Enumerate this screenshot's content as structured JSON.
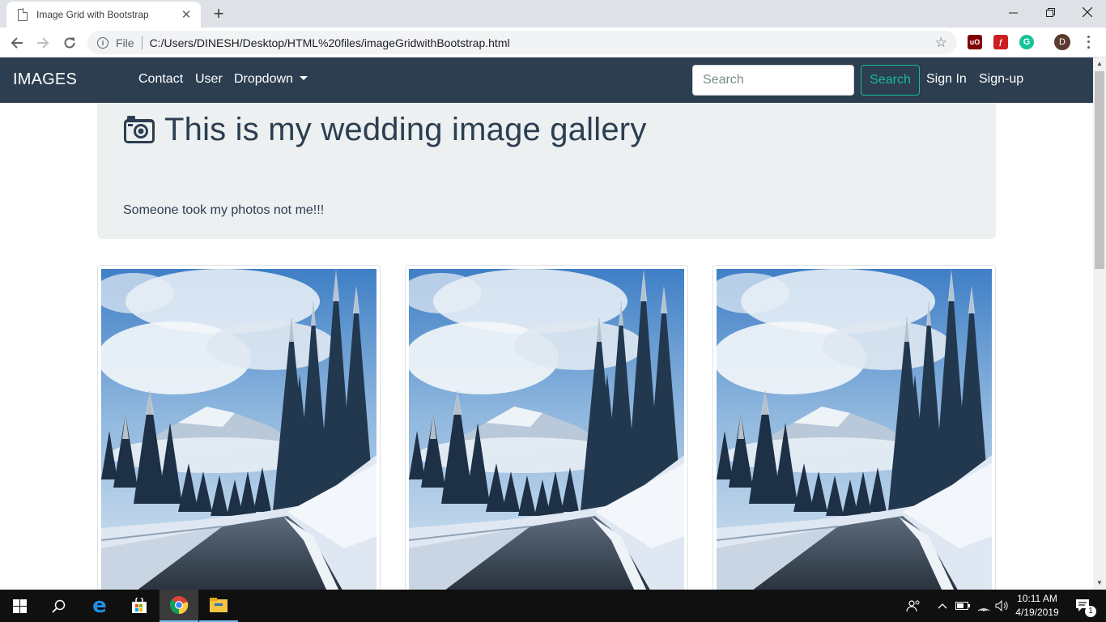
{
  "browser": {
    "tab_title": "Image Grid with Bootstrap",
    "file_label": "File",
    "url": "C:/Users/DINESH/Desktop/HTML%20files/imageGridwithBootstrap.html",
    "profile_initial": "D"
  },
  "site": {
    "brand": "IMAGES",
    "nav": {
      "contact": "Contact",
      "user": "User",
      "dropdown": "Dropdown"
    },
    "search": {
      "placeholder": "Search",
      "button": "Search"
    },
    "signin": "Sign In",
    "signup": "Sign-up",
    "jumbotron": {
      "title": "This is my wedding image gallery",
      "lead": "Someone took my photos not me!!!"
    },
    "gallery": [
      "photo-1",
      "photo-2",
      "photo-3"
    ],
    "colors": {
      "navbar": "#2c3e50",
      "jumbotron": "#ecf0f1",
      "accent": "#18bc9c"
    }
  },
  "taskbar": {
    "time": "10:11 AM",
    "date": "4/19/2019",
    "notification_count": "1"
  }
}
